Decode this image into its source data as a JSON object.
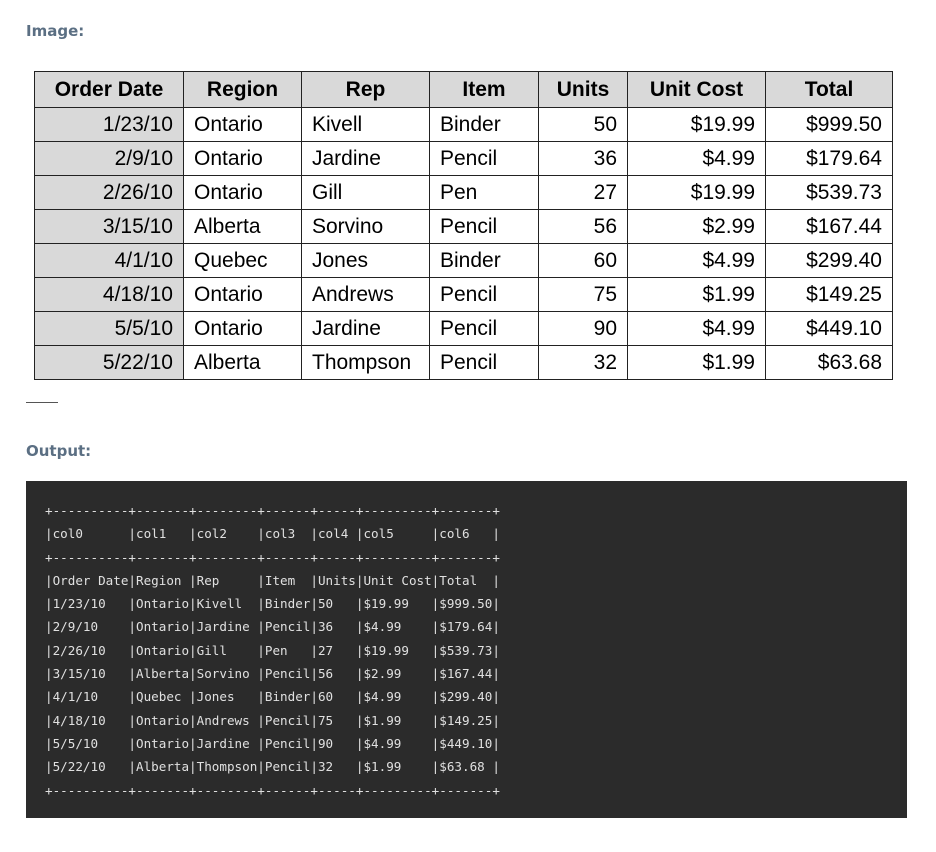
{
  "labels": {
    "image": "Image:",
    "output": "Output:"
  },
  "table": {
    "headers": [
      "Order Date",
      "Region",
      "Rep",
      "Item",
      "Units",
      "Unit Cost",
      "Total"
    ],
    "rows": [
      [
        "1/23/10",
        "Ontario",
        "Kivell",
        "Binder",
        "50",
        "$19.99",
        "$999.50"
      ],
      [
        "2/9/10",
        "Ontario",
        "Jardine",
        "Pencil",
        "36",
        "$4.99",
        "$179.64"
      ],
      [
        "2/26/10",
        "Ontario",
        "Gill",
        "Pen",
        "27",
        "$19.99",
        "$539.73"
      ],
      [
        "3/15/10",
        "Alberta",
        "Sorvino",
        "Pencil",
        "56",
        "$2.99",
        "$167.44"
      ],
      [
        "4/1/10",
        "Quebec",
        "Jones",
        "Binder",
        "60",
        "$4.99",
        "$299.40"
      ],
      [
        "4/18/10",
        "Ontario",
        "Andrews",
        "Pencil",
        "75",
        "$1.99",
        "$149.25"
      ],
      [
        "5/5/10",
        "Ontario",
        "Jardine",
        "Pencil",
        "90",
        "$4.99",
        "$449.10"
      ],
      [
        "5/22/10",
        "Alberta",
        "Thompson",
        "Pencil",
        "32",
        "$1.99",
        "$63.68"
      ]
    ]
  },
  "console": {
    "lines": [
      "+----------+-------+--------+------+-----+---------+-------+",
      "|col0      |col1   |col2    |col3  |col4 |col5     |col6   |",
      "+----------+-------+--------+------+-----+---------+-------+",
      "|Order Date|Region |Rep     |Item  |Units|Unit Cost|Total  |",
      "|1/23/10   |Ontario|Kivell  |Binder|50   |$19.99   |$999.50|",
      "|2/9/10    |Ontario|Jardine |Pencil|36   |$4.99    |$179.64|",
      "|2/26/10   |Ontario|Gill    |Pen   |27   |$19.99   |$539.73|",
      "|3/15/10   |Alberta|Sorvino |Pencil|56   |$2.99    |$167.44|",
      "|4/1/10    |Quebec |Jones   |Binder|60   |$4.99    |$299.40|",
      "|4/18/10   |Ontario|Andrews |Pencil|75   |$1.99    |$149.25|",
      "|5/5/10    |Ontario|Jardine |Pencil|90   |$4.99    |$449.10|",
      "|5/22/10   |Alberta|Thompson|Pencil|32   |$1.99    |$63.68 |",
      "+----------+-------+--------+------+-----+---------+-------+"
    ]
  }
}
